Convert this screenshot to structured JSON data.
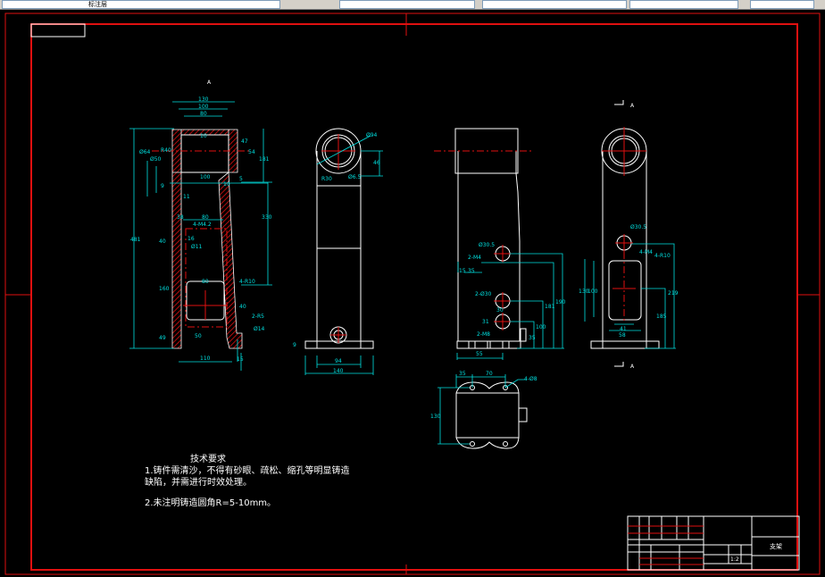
{
  "toolbar": {
    "layer_name": "标注层"
  },
  "notes": {
    "title": "技术要求",
    "line1": "1.铸件需清沙，不得有砂眼、疏松、缩孔等明显铸造",
    "line1b": "缺陷，并需进行时效处理。",
    "line2": "2.未注明铸造圆角R=5-10mm。"
  },
  "section_label": "A",
  "view_a_label": "A",
  "dims": {
    "v1": [
      "130",
      "100",
      "80",
      "10",
      "47",
      "54",
      "181",
      "Ø64",
      "Ø50",
      "R40",
      "100",
      "10",
      "5",
      "9",
      "11",
      "330",
      "481",
      "80",
      "38",
      "4-M4.2",
      "16",
      "Ø11",
      "40",
      "160",
      "80",
      "4-R10",
      "40",
      "2-R5",
      "Ø14",
      "50",
      "49",
      "110",
      "15"
    ],
    "v2": [
      "Ø94",
      "46",
      "R30",
      "Ø6.5",
      "9",
      "94",
      "140"
    ],
    "v3": [
      "Ø30.5",
      "2-M4",
      "15",
      "35",
      "2-Ø30",
      "30",
      "31",
      "2-M8",
      "55",
      "100",
      "181",
      "190",
      "35"
    ],
    "v4": [
      "Ø30.5",
      "4-M4",
      "4-R10",
      "130",
      "100",
      "219",
      "185",
      "41",
      "58"
    ],
    "v5": [
      "35",
      "70",
      "4-Ø8",
      "130"
    ]
  },
  "title_block": {
    "scale": "1:2",
    "part": "支架"
  },
  "colors": {
    "frame": "#e01010",
    "outline": "#ffffff",
    "dimension": "#00e0e0",
    "center": "#e01010"
  }
}
